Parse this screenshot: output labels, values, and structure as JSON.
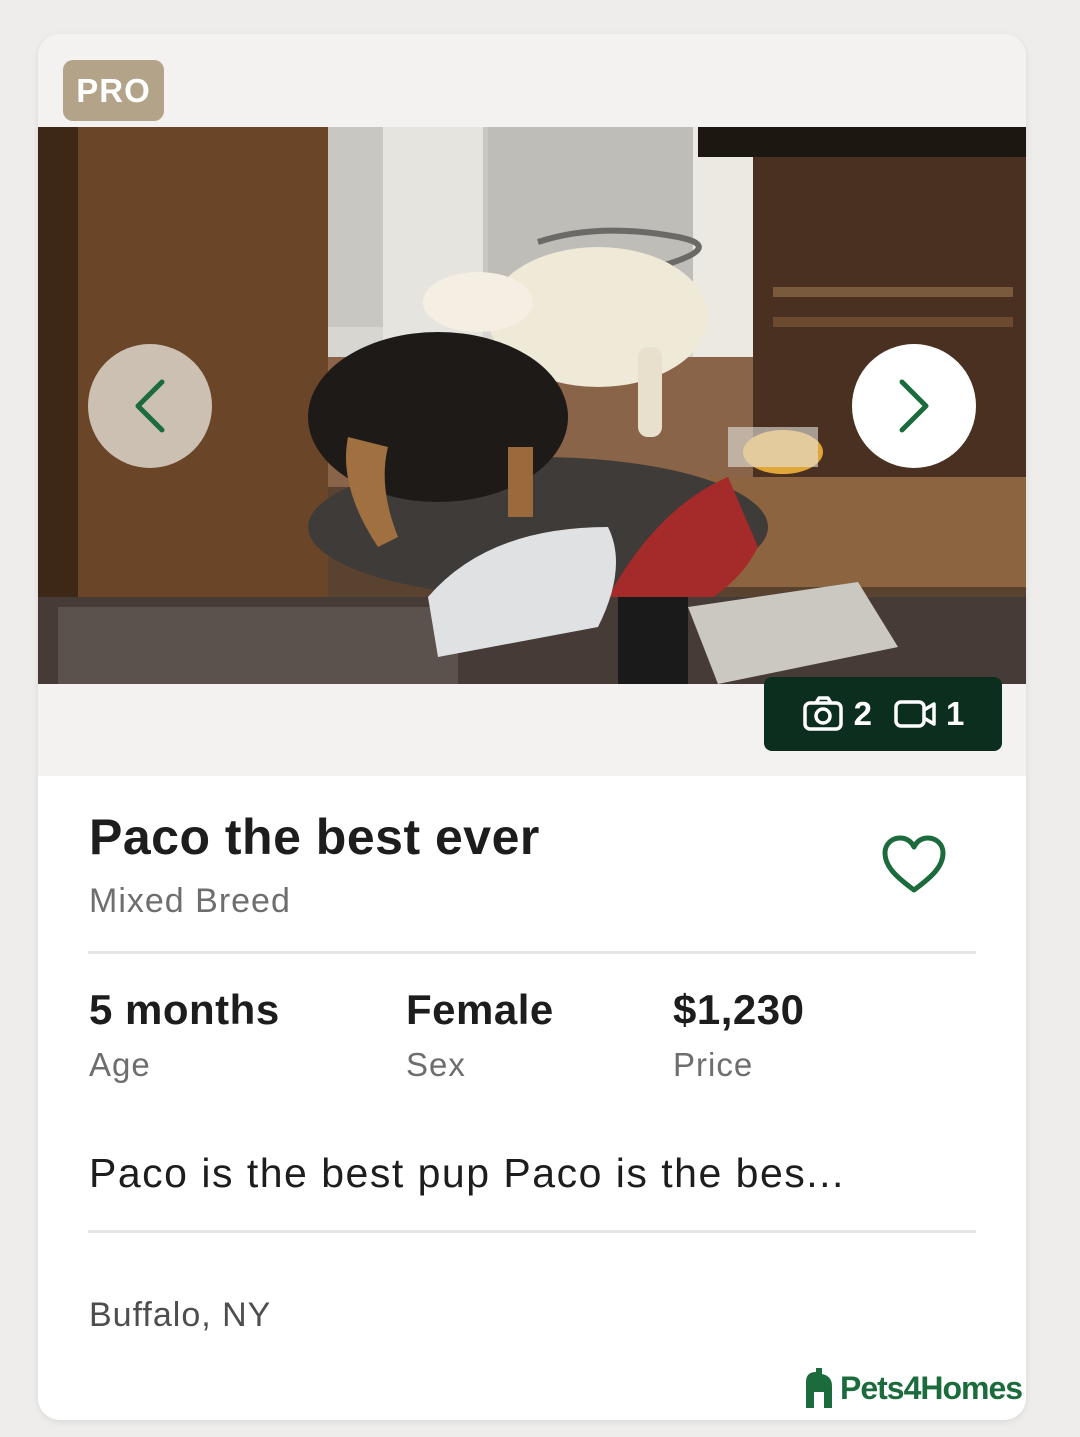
{
  "listing": {
    "badge": "PRO",
    "title": "Paco the best ever",
    "breed": "Mixed Breed",
    "media": {
      "photos": "2",
      "videos": "1"
    },
    "stats": [
      {
        "value": "5 months",
        "label": "Age"
      },
      {
        "value": "Female",
        "label": "Sex"
      },
      {
        "value": "$1,230",
        "label": "Price"
      }
    ],
    "description": "Paco is the best pup Paco is the bes...",
    "location": "Buffalo, NY"
  },
  "photo": {
    "alt": "Photo of two dogs in a living room"
  },
  "icons": {
    "prev": "chevron-left-icon",
    "next": "chevron-right-icon",
    "camera": "camera-icon",
    "video": "video-icon",
    "favorite": "heart-icon"
  },
  "brand": {
    "logo_text": "Pets4Homes",
    "accent": "#1c6b3c",
    "dark": "#0b2e1e",
    "badge": "#b3a489"
  }
}
